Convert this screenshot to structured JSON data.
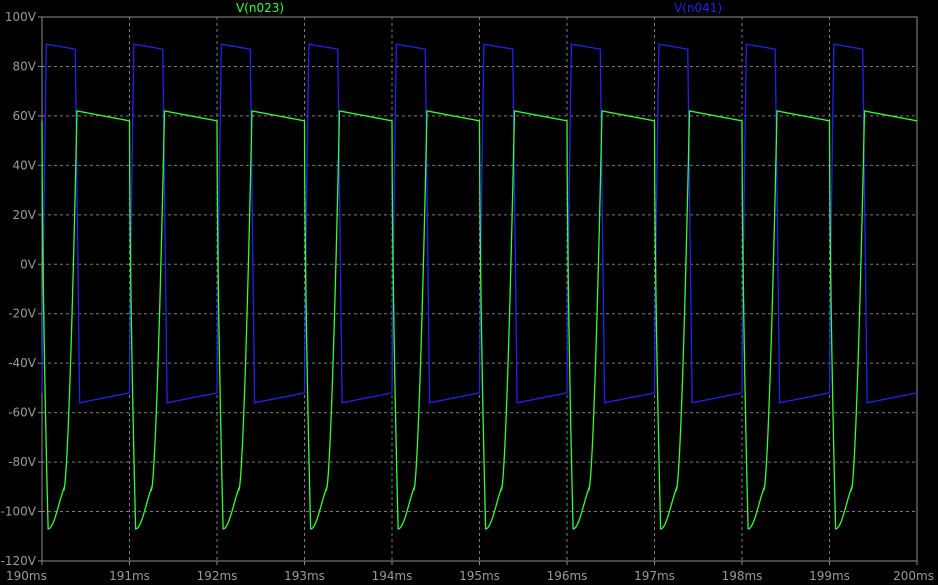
{
  "chart_data": {
    "type": "line",
    "title": "",
    "xlabel": "",
    "ylabel": "",
    "xlim": [
      190,
      200
    ],
    "ylim": [
      -120,
      100
    ],
    "x_unit": "ms",
    "y_unit": "V",
    "grid": true,
    "legend_placement": "top",
    "x_ticks": [
      "190ms",
      "191ms",
      "192ms",
      "193ms",
      "194ms",
      "195ms",
      "196ms",
      "197ms",
      "198ms",
      "199ms",
      "200ms"
    ],
    "y_ticks": [
      "100V",
      "80V",
      "60V",
      "40V",
      "20V",
      "0V",
      "-20V",
      "-40V",
      "-60V",
      "-80V",
      "-100V",
      "-120V"
    ],
    "series": [
      {
        "name": "V(n023)",
        "color": "#33ff33",
        "period_ms": 1.0,
        "first_x_ms": 190.0,
        "waveform": {
          "plateau_start_V": 62,
          "plateau_end_V": 58,
          "trough_V": -107,
          "trough_offset_ms": 0.07,
          "rise_offset_ms": 0.4
        }
      },
      {
        "name": "V(n041)",
        "color": "#2222ee",
        "period_ms": 1.0,
        "first_x_ms": 190.0,
        "waveform": {
          "high_start_V": 89,
          "high_end_V": 87,
          "low_start_V": -56,
          "low_end_V": -52,
          "rise_offset_ms": 0.05,
          "fall_offset_ms": 0.4
        }
      }
    ]
  }
}
